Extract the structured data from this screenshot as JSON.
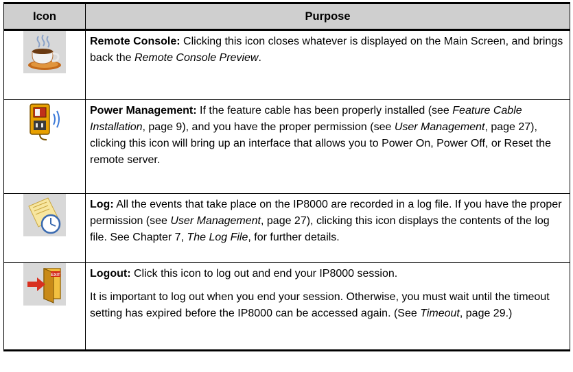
{
  "table": {
    "headers": [
      "Icon",
      "Purpose"
    ],
    "rows": [
      {
        "icon": "coffee-cup-icon",
        "title": "Remote Console:",
        "t1": " Clicking this icon closes whatever is displayed on the Main Screen, and brings back the ",
        "i1": "Remote Console Preview",
        "t2": "."
      },
      {
        "icon": "power-management-icon",
        "title": "Power Management:",
        "t1": " If the feature cable has been properly installed (see ",
        "i1": "Feature Cable Installation",
        "t2": ", page 9), and you have the proper permission (see ",
        "i2": "User Management",
        "t3": ", page 27), clicking this icon will bring up an interface that allows you to Power On, Power Off, or Reset the remote server."
      },
      {
        "icon": "log-clock-icon",
        "title": "Log:",
        "t1": " All the events that take place on the IP8000 are recorded in a log file. If you have the proper permission (see ",
        "i1": "User Management",
        "t2": ", page 27), clicking this icon displays the contents of the log file. See Chapter 7, ",
        "i2": "The Log File",
        "t3": ", for further details."
      },
      {
        "icon": "logout-exit-icon",
        "title": "Logout:",
        "t1": " Click this icon to log out and end your IP8000 session.",
        "p2a": "It is important to log out when you end your session. Otherwise, you must wait until the timeout setting has expired before the IP8000 can be accessed again. (See ",
        "i1": "Timeout",
        "p2b": ", page 29.)"
      }
    ]
  },
  "icon_labels": {
    "logout": "EXIT"
  }
}
